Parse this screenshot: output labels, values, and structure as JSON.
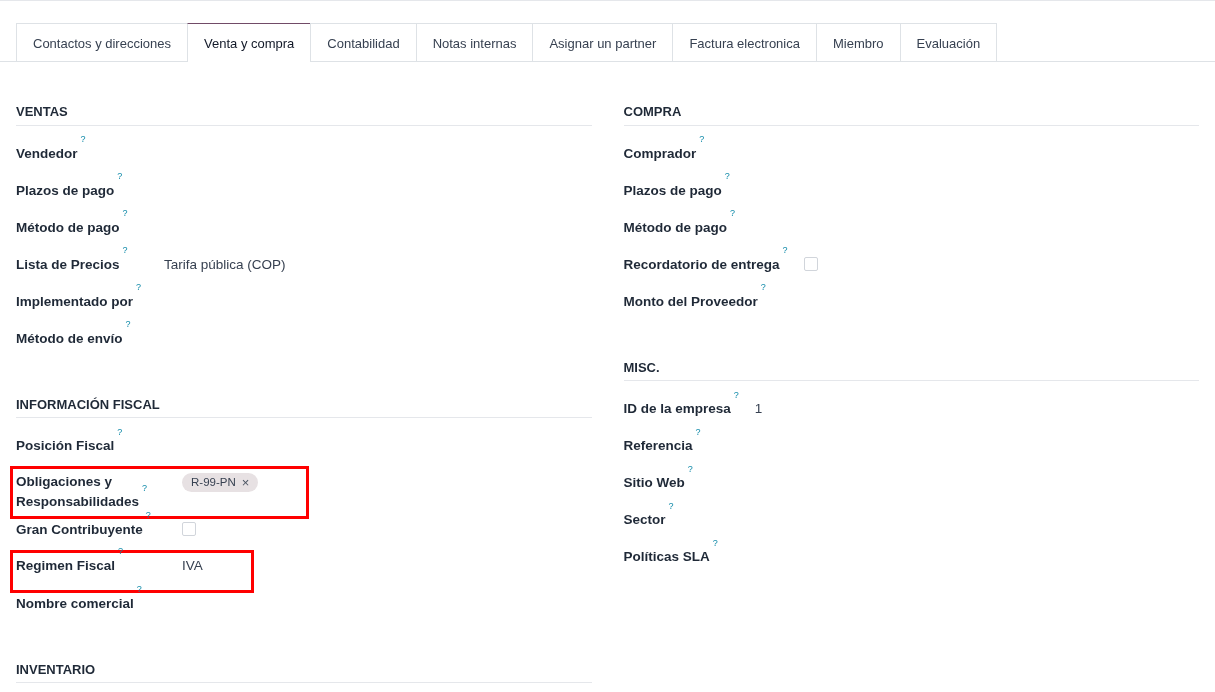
{
  "tabs": [
    {
      "label": "Contactos y direcciones",
      "selected": false
    },
    {
      "label": "Venta y compra",
      "selected": true
    },
    {
      "label": "Contabilidad",
      "selected": false
    },
    {
      "label": "Notas internas",
      "selected": false
    },
    {
      "label": "Asignar un partner",
      "selected": false
    },
    {
      "label": "Factura electronica",
      "selected": false
    },
    {
      "label": "Miembro",
      "selected": false
    },
    {
      "label": "Evaluación",
      "selected": false
    }
  ],
  "columns": [
    {
      "sections": [
        {
          "title": "VENTAS",
          "fields": [
            {
              "label": "Vendedor",
              "help": "?",
              "kind": "empty",
              "highlighted": false
            },
            {
              "label": "Plazos de pago",
              "help": "?",
              "kind": "empty",
              "highlighted": false
            },
            {
              "label": "Método de pago",
              "help": "?",
              "kind": "empty",
              "highlighted": false
            },
            {
              "label": "Lista de Precios",
              "help": "?",
              "kind": "text",
              "value": "Tarifa pública (COP)",
              "highlighted": false
            },
            {
              "label": "Implementado por",
              "help": "?",
              "kind": "empty",
              "highlighted": false
            },
            {
              "label": "Método de envío",
              "help": "?",
              "kind": "empty",
              "highlighted": false
            }
          ]
        },
        {
          "title": "INFORMACIÓN FISCAL",
          "fields": [
            {
              "label": "Posición Fiscal",
              "help": "?",
              "kind": "empty",
              "highlighted": false
            },
            {
              "label": "Obligaciones y Responsabilidades",
              "help": "?",
              "kind": "tags",
              "tags": [
                {
                  "label": "R-99-PN",
                  "remove": "×"
                }
              ],
              "highlighted": true
            },
            {
              "label": "Gran Contribuyente",
              "help": "?",
              "kind": "checkbox",
              "checked": false,
              "highlighted": false
            },
            {
              "label": "Regimen Fiscal",
              "help": "?",
              "kind": "text",
              "value": "IVA",
              "highlighted": true
            },
            {
              "label": "Nombre comercial",
              "help": "?",
              "kind": "empty",
              "highlighted": false
            }
          ]
        },
        {
          "title": "INVENTARIO"
        }
      ]
    },
    {
      "sections": [
        {
          "title": "COMPRA",
          "fields": [
            {
              "label": "Comprador",
              "help": "?",
              "kind": "empty",
              "highlighted": false
            },
            {
              "label": "Plazos de pago",
              "help": "?",
              "kind": "empty",
              "highlighted": false
            },
            {
              "label": "Método de pago",
              "help": "?",
              "kind": "empty",
              "highlighted": false
            },
            {
              "label": "Recordatorio de entrega",
              "help": "?",
              "kind": "checkbox",
              "checked": false,
              "highlighted": false
            },
            {
              "label": "Monto del Proveedor",
              "help": "?",
              "kind": "empty",
              "highlighted": false
            }
          ]
        },
        {
          "title": "MISC.",
          "fields": [
            {
              "label": "ID de la empresa",
              "help": "?",
              "kind": "text",
              "value": "1",
              "highlighted": false
            },
            {
              "label": "Referencia",
              "help": "?",
              "kind": "empty",
              "highlighted": false
            },
            {
              "label": "Sitio Web",
              "help": "?",
              "kind": "empty",
              "highlighted": false
            },
            {
              "label": "Sector",
              "help": "?",
              "kind": "empty",
              "highlighted": false
            },
            {
              "label": "Políticas SLA",
              "help": "?",
              "kind": "empty",
              "highlighted": false
            }
          ]
        }
      ]
    }
  ]
}
